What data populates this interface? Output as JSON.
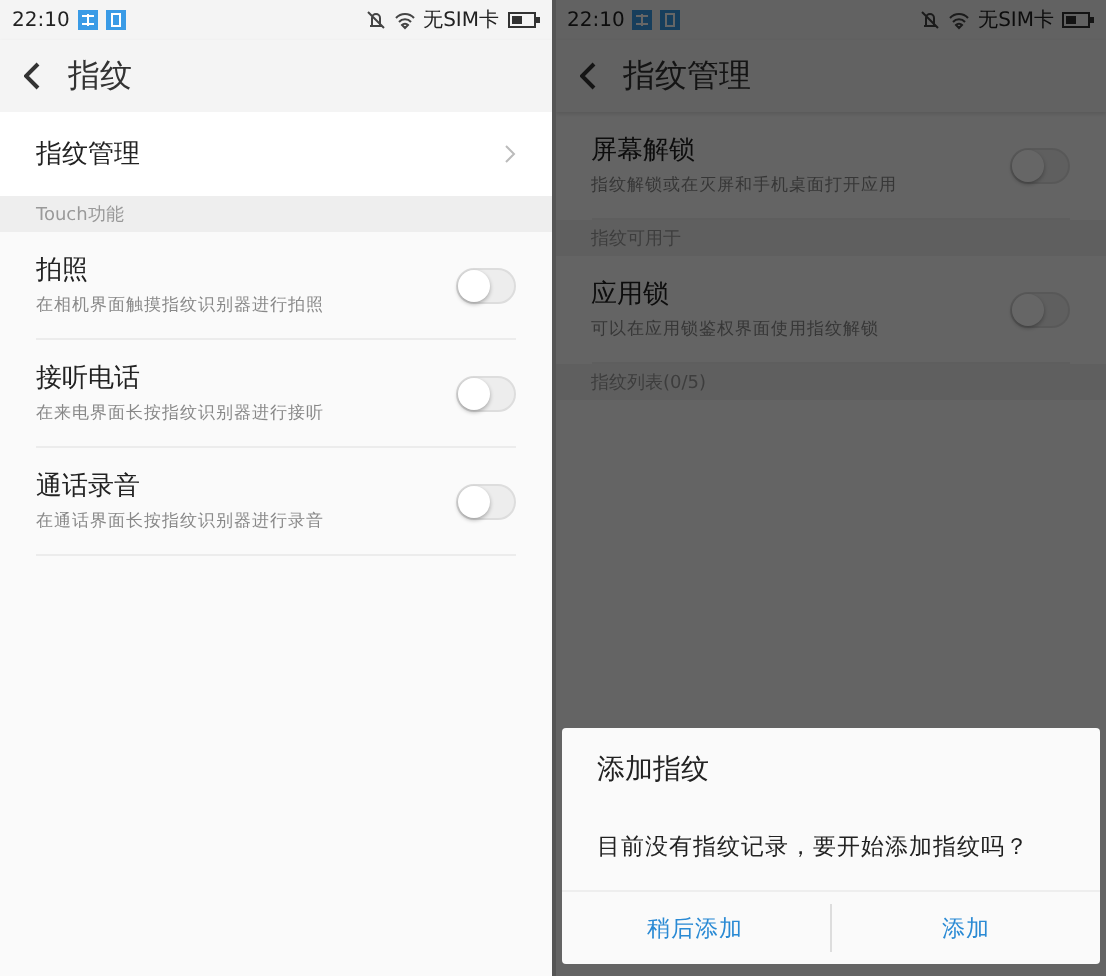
{
  "screens": [
    {
      "status_bar": {
        "time": "22:10",
        "carrier": "无SIM卡"
      },
      "header": {
        "title": "指纹"
      },
      "dimmed": false,
      "items": [
        {
          "kind": "link",
          "title": "指纹管理"
        },
        {
          "kind": "section",
          "title": "Touch功能"
        },
        {
          "kind": "toggle",
          "title": "拍照",
          "subtitle": "在相机界面触摸指纹识别器进行拍照",
          "on": false
        },
        {
          "kind": "toggle",
          "title": "接听电话",
          "subtitle": "在来电界面长按指纹识别器进行接听",
          "on": false
        },
        {
          "kind": "toggle",
          "title": "通话录音",
          "subtitle": "在通话界面长按指纹识别器进行录音",
          "on": false
        }
      ]
    },
    {
      "status_bar": {
        "time": "22:10",
        "carrier": "无SIM卡"
      },
      "header": {
        "title": "指纹管理"
      },
      "dimmed": true,
      "items": [
        {
          "kind": "toggle",
          "title": "屏幕解锁",
          "subtitle": "指纹解锁或在灭屏和手机桌面打开应用",
          "on": false
        },
        {
          "kind": "section",
          "title": "指纹可用于"
        },
        {
          "kind": "toggle",
          "title": "应用锁",
          "subtitle": "可以在应用锁鉴权界面使用指纹解锁",
          "on": false
        },
        {
          "kind": "section",
          "title": "指纹列表(0/5)"
        }
      ],
      "dialog": {
        "title": "添加指纹",
        "message": "目前没有指纹记录，要开始添加指纹吗？",
        "buttons": [
          "稍后添加",
          "添加"
        ]
      }
    }
  ]
}
